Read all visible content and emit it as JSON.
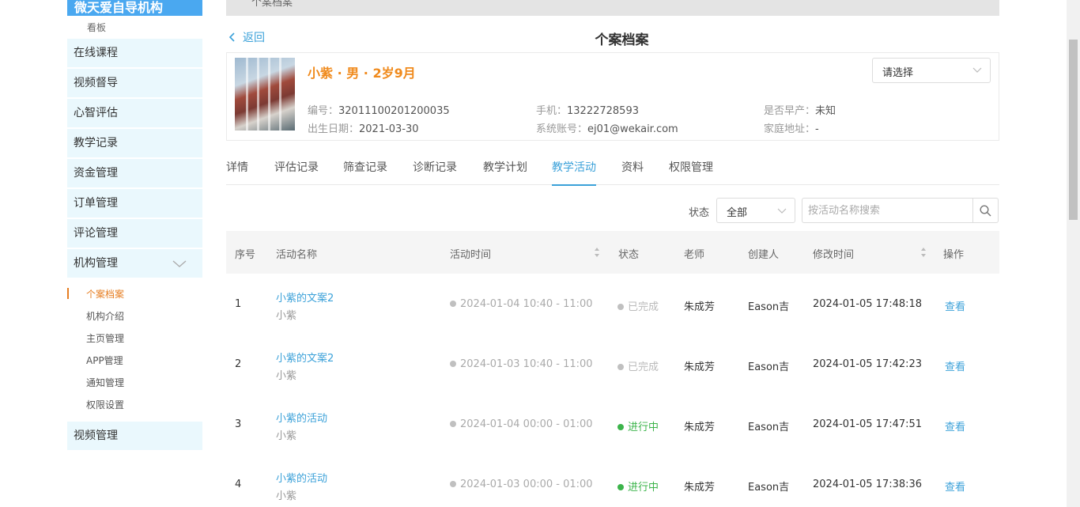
{
  "sidebar": {
    "brand": "微天爱自导机构",
    "kanban": "看板",
    "menu": [
      "在线课程",
      "视频督导",
      "心智评估",
      "教学记录",
      "资金管理",
      "订单管理",
      "评论管理",
      "机构管理"
    ],
    "submenu": [
      "个案档案",
      "机构介绍",
      "主页管理",
      "APP管理",
      "通知管理",
      "权限设置"
    ],
    "last": "视频管理"
  },
  "topbar": {
    "crumb": "个案档案"
  },
  "header": {
    "back": "返回",
    "title": "个案档案"
  },
  "profile": {
    "name": "小紫 · 男 · 2岁9月",
    "code_label": "编号：",
    "code": "32011100201200035",
    "birth_label": "出生日期：",
    "birth": "2021-03-30",
    "phone_label": "手机：",
    "phone": "13222728593",
    "account_label": "系统账号：",
    "account": "ej01@wekair.com",
    "premature_label": "是否早产：",
    "premature": "未知",
    "address_label": "家庭地址：",
    "address": "-",
    "select": "请选择"
  },
  "tabs": [
    "详情",
    "评估记录",
    "筛查记录",
    "诊断记录",
    "教学计划",
    "教学活动",
    "资料",
    "权限管理"
  ],
  "active_tab": "教学活动",
  "filter": {
    "status_label": "状态",
    "status_value": "全部",
    "search_placeholder": "按活动名称搜索"
  },
  "table": {
    "headers": [
      "序号",
      "活动名称",
      "活动时间",
      "状态",
      "老师",
      "创建人",
      "修改时间",
      "操作"
    ],
    "rows": [
      {
        "idx": "1",
        "name": "小紫的文案2",
        "sub": "小紫",
        "time": "2024-01-04 10:40 - 11:00",
        "status": "已完成",
        "status_type": "done",
        "teacher": "朱成芳",
        "creator": "Eason吉",
        "modified": "2024-01-05 17:48:18",
        "op": "查看"
      },
      {
        "idx": "2",
        "name": "小紫的文案2",
        "sub": "小紫",
        "time": "2024-01-03 10:40 - 11:00",
        "status": "已完成",
        "status_type": "done",
        "teacher": "朱成芳",
        "creator": "Eason吉",
        "modified": "2024-01-05 17:42:23",
        "op": "查看"
      },
      {
        "idx": "3",
        "name": "小紫的活动",
        "sub": "小紫",
        "time": "2024-01-04 00:00 - 01:00",
        "status": "进行中",
        "status_type": "active",
        "teacher": "朱成芳",
        "creator": "Eason吉",
        "modified": "2024-01-05 17:47:51",
        "op": "查看"
      },
      {
        "idx": "4",
        "name": "小紫的活动",
        "sub": "小紫",
        "time": "2024-01-03 00:00 - 01:00",
        "status": "进行中",
        "status_type": "active",
        "teacher": "朱成芳",
        "creator": "Eason吉",
        "modified": "2024-01-05 17:38:36",
        "op": "查看"
      }
    ]
  },
  "colors": {
    "accent": "#3ba1d9",
    "orange": "#f08a1c",
    "active_green": "#3cb44b",
    "done_gray": "#c0c0c0"
  }
}
